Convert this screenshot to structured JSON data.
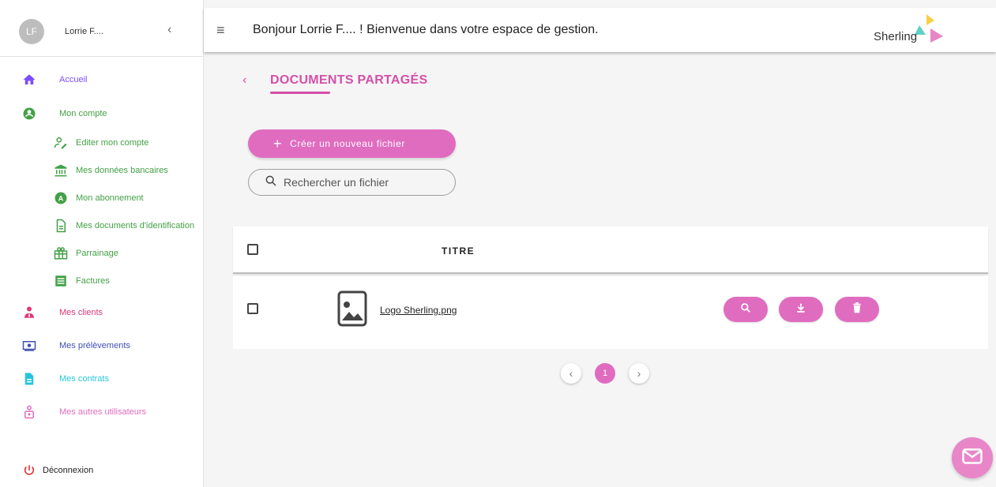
{
  "sidebar": {
    "avatar_initials": "LF",
    "user_name": "Lorrie F....",
    "collapse_icon": "chevron-left-icon",
    "items": [
      {
        "label": "Accueil",
        "icon": "home-icon",
        "color": "#7c4dff"
      },
      {
        "label": "Mon compte",
        "icon": "account-circle-icon",
        "color": "#43a047"
      },
      {
        "label": "Editer mon compte",
        "icon": "edit-account-icon",
        "color": "#43a047"
      },
      {
        "label": "Mes données bancaires",
        "icon": "bank-icon",
        "color": "#43a047"
      },
      {
        "label": "Mon abonnement",
        "icon": "subscription-icon",
        "color": "#43a047"
      },
      {
        "label": "Mes documents d'identification",
        "icon": "document-icon",
        "color": "#43a047"
      },
      {
        "label": "Parrainage",
        "icon": "gift-icon",
        "color": "#43a047"
      },
      {
        "label": "Factures",
        "icon": "invoice-icon",
        "color": "#43a047"
      },
      {
        "label": "Mes clients",
        "icon": "clients-icon",
        "color": "#e0377a"
      },
      {
        "label": "Mes prélèvements",
        "icon": "money-icon",
        "color": "#3f51b5"
      },
      {
        "label": "Mes contrats",
        "icon": "contract-icon",
        "color": "#26c6da"
      },
      {
        "label": "Mes autres utilisateurs",
        "icon": "users-icon",
        "color": "#e06cbf"
      }
    ],
    "logout_label": "Déconnexion",
    "logout_color": "#e53935"
  },
  "header": {
    "greeting": "Bonjour Lorrie F.... ! Bienvenue dans votre espace de gestion.",
    "logo_text": "Sherling"
  },
  "main": {
    "title": "DOCUMENTS PARTAGÉS",
    "create_label": "Créer un nouveau fichier",
    "search_placeholder": "Rechercher un fichier",
    "table": {
      "column_title": "TITRE",
      "rows": [
        {
          "file_name": "Logo Sherling.png",
          "icon": "image-file-icon"
        }
      ],
      "actions": [
        "search-icon",
        "download-icon",
        "delete-icon"
      ]
    },
    "pagination": {
      "current_page": "1"
    }
  },
  "colors": {
    "accent": "#e06cbf",
    "title": "#d44fa9"
  }
}
